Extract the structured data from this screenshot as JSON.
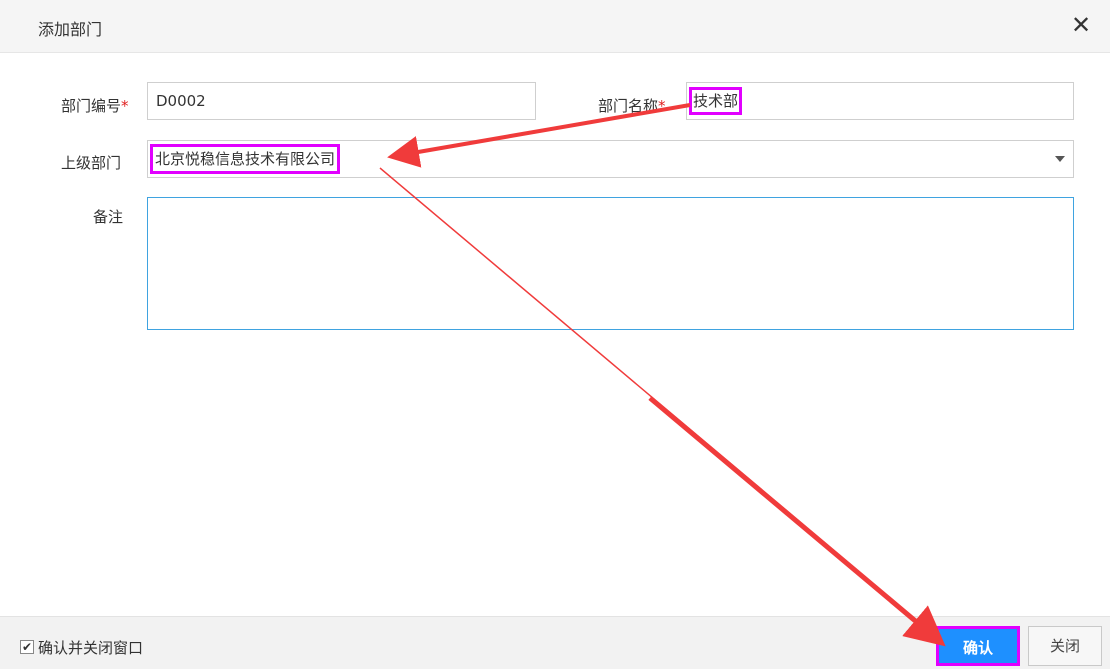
{
  "dialog": {
    "title": "添加部门",
    "close_icon": "close-icon"
  },
  "form": {
    "dept_code": {
      "label": "部门编号",
      "required_mark": "*",
      "value": "D0002"
    },
    "dept_name": {
      "label": "部门名称",
      "required_mark": "*",
      "value": "技术部"
    },
    "parent_dept": {
      "label": "上级部门",
      "value": "北京悦稳信息技术有限公司"
    },
    "remark": {
      "label": "备注",
      "value": ""
    }
  },
  "footer": {
    "checkbox_checked": true,
    "checkbox_label": "确认并关闭窗口",
    "confirm_label": "确认",
    "close_label": "关闭"
  },
  "colors": {
    "highlight": "#e100ff",
    "arrow": "#f03b3b",
    "primary": "#1e90ff"
  }
}
